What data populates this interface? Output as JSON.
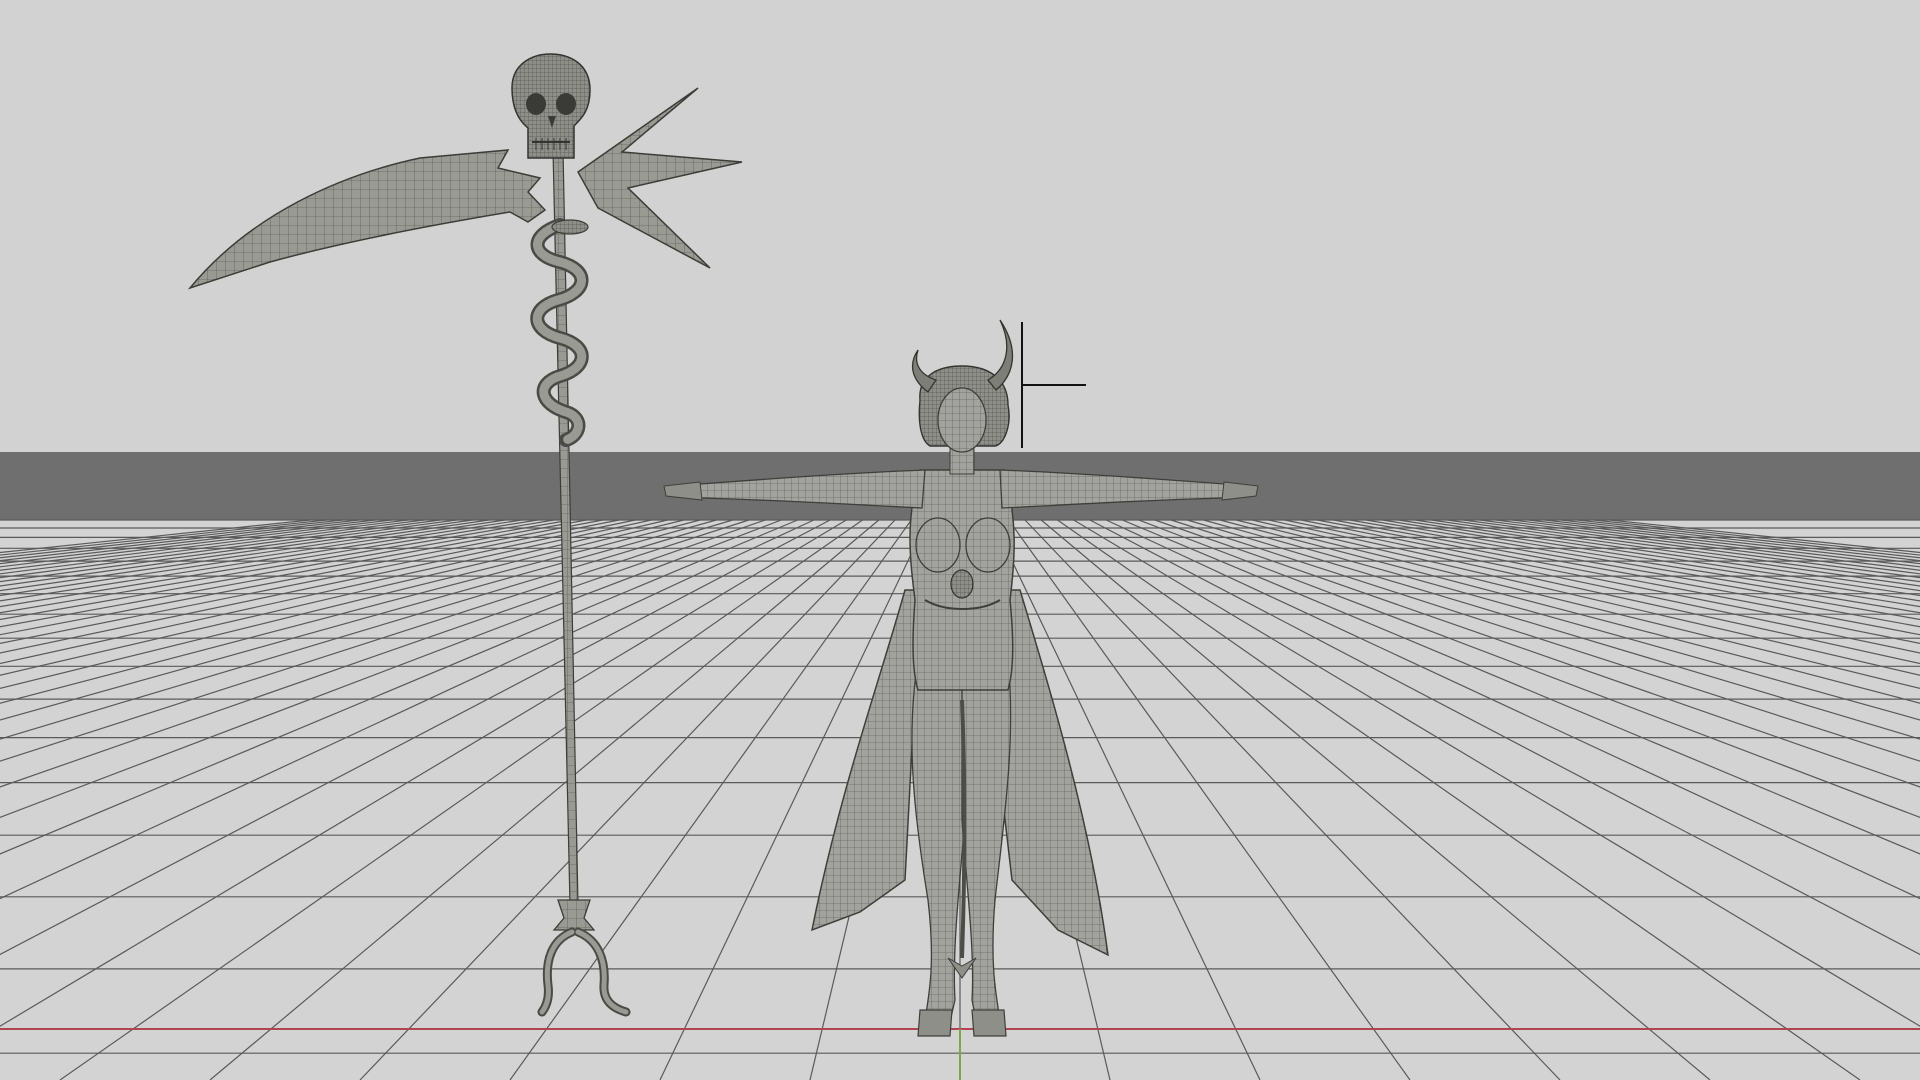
{
  "viewport": {
    "background_color": "#d2d2d2",
    "horizon_band_color": "#6f6f6f",
    "floor_color": "#d3d3d3",
    "grid_line_color": "#5a5a5a",
    "x_axis_color": "#b0454f",
    "y_axis_color": "#7fa64c",
    "cursor_color": "#111111"
  },
  "objects": {
    "scythe": {
      "mesh_color": "#9a9a94",
      "wire_color": "#4a4a46",
      "parts": [
        "skull",
        "crescent-blade",
        "spike-blade",
        "serpent",
        "shaft",
        "claw-foot"
      ]
    },
    "character": {
      "mesh_color": "#a2a29e",
      "wire_color": "#4c4c48",
      "parts": [
        "horns",
        "head",
        "torso",
        "arms",
        "coat",
        "legs",
        "tail"
      ]
    }
  }
}
